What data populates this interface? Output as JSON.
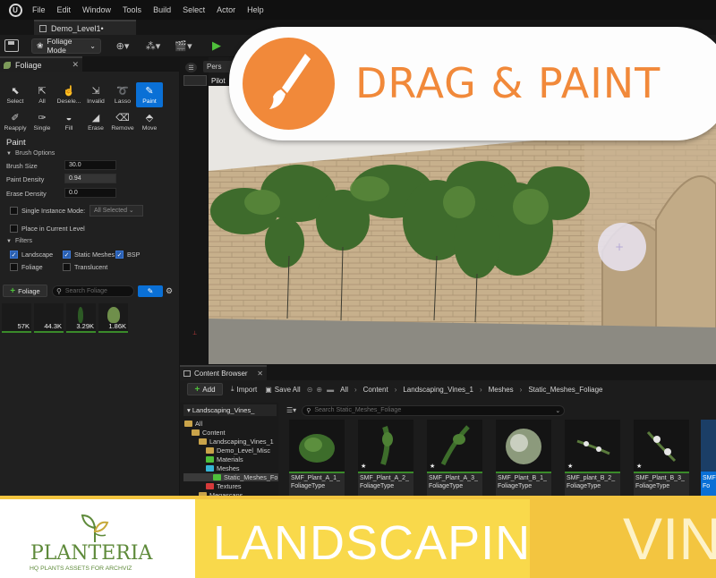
{
  "menubar": {
    "items": [
      "File",
      "Edit",
      "Window",
      "Tools",
      "Build",
      "Select",
      "Actor",
      "Help"
    ]
  },
  "level_tab": "Demo_Level1•",
  "toolbar": {
    "mode_select": "Foliage Mode"
  },
  "foliage_tab": "Foliage",
  "tools_row1": [
    {
      "icon": "select-icon",
      "label": "Select"
    },
    {
      "icon": "all-icon",
      "label": "All"
    },
    {
      "icon": "deselect-icon",
      "label": "Desele..."
    },
    {
      "icon": "invalid-icon",
      "label": "Invalid"
    },
    {
      "icon": "lasso-icon",
      "label": "Lasso"
    },
    {
      "icon": "paint-icon",
      "label": "Paint",
      "active": true
    }
  ],
  "tools_row2": [
    {
      "icon": "reapply-icon",
      "label": "Reapply"
    },
    {
      "icon": "single-icon",
      "label": "Single"
    },
    {
      "icon": "fill-icon",
      "label": "Fill"
    },
    {
      "icon": "erase-icon",
      "label": "Erase"
    },
    {
      "icon": "remove-icon",
      "label": "Remove"
    },
    {
      "icon": "move-icon",
      "label": "Move"
    }
  ],
  "paint": {
    "title": "Paint",
    "brush_options_label": "Brush Options",
    "brush_size_label": "Brush Size",
    "brush_size": "30.0",
    "paint_density_label": "Paint Density",
    "paint_density": "0.94",
    "erase_density_label": "Erase Density",
    "erase_density": "0.0",
    "single_instance_label": "Single Instance Mode:",
    "single_instance_value": "All Selected",
    "place_in_level_label": "Place in Current Level",
    "filters_label": "Filters",
    "filters": {
      "landscape": "Landscape",
      "static_meshes": "Static Meshes",
      "bsp": "BSP",
      "foliage": "Foliage",
      "translucent": "Translucent"
    }
  },
  "foliage_bar": {
    "add_label": "Foliage",
    "search_placeholder": "Search Foliage"
  },
  "foliage_thumbs": [
    "57K",
    "44.3K",
    "3.29K",
    "1.86K"
  ],
  "viewport": {
    "perspective_label": "Pers",
    "pilot_label": "Pilot"
  },
  "banner": {
    "title": "DRAG & PAINT"
  },
  "content_browser": {
    "tab": "Content Browser",
    "add_label": "Add",
    "import_label": "Import",
    "save_all_label": "Save All",
    "breadcrumbs": [
      "All",
      "Content",
      "Landscaping_Vines_1",
      "Meshes",
      "Static_Meshes_Foliage"
    ],
    "tree_header": "Landscaping_Vines_",
    "tree": [
      "All",
      "Content",
      "Landscaping_Vines_1",
      "Demo_Level_Misc",
      "Materials",
      "Meshes",
      "Static_Meshes_Fo",
      "Textures",
      "Megascans"
    ],
    "search_placeholder": "Search Static_Meshes_Foliage",
    "assets": [
      {
        "line1": "SMF_Plant_A_1_",
        "line2": "FoliageType"
      },
      {
        "line1": "SMF_Plant_A_2_",
        "line2": "FoliageType"
      },
      {
        "line1": "SMF_Plant_A_3_",
        "line2": "FoliageType"
      },
      {
        "line1": "SMF_Plant_B_1_",
        "line2": "FoliageType"
      },
      {
        "line1": "SMF_plant_B_2_",
        "line2": "FoliageType"
      },
      {
        "line1": "SMF_Plant_B_3_",
        "line2": "FoliageType"
      },
      {
        "line1": "SMF",
        "line2": "Fo"
      }
    ]
  },
  "brand": {
    "logo_name": "PLANTERIA",
    "logo_subtitle": "HQ PLANTS ASSETS FOR ARCHVIZ",
    "landscaping": "LANDSCAPING",
    "vines": "VINES"
  },
  "colors": {
    "accent_orange": "#f1893a",
    "brand_yellow": "#f9d94b",
    "ue_blue": "#0a70d6",
    "asset_green": "#3a8a2a"
  }
}
